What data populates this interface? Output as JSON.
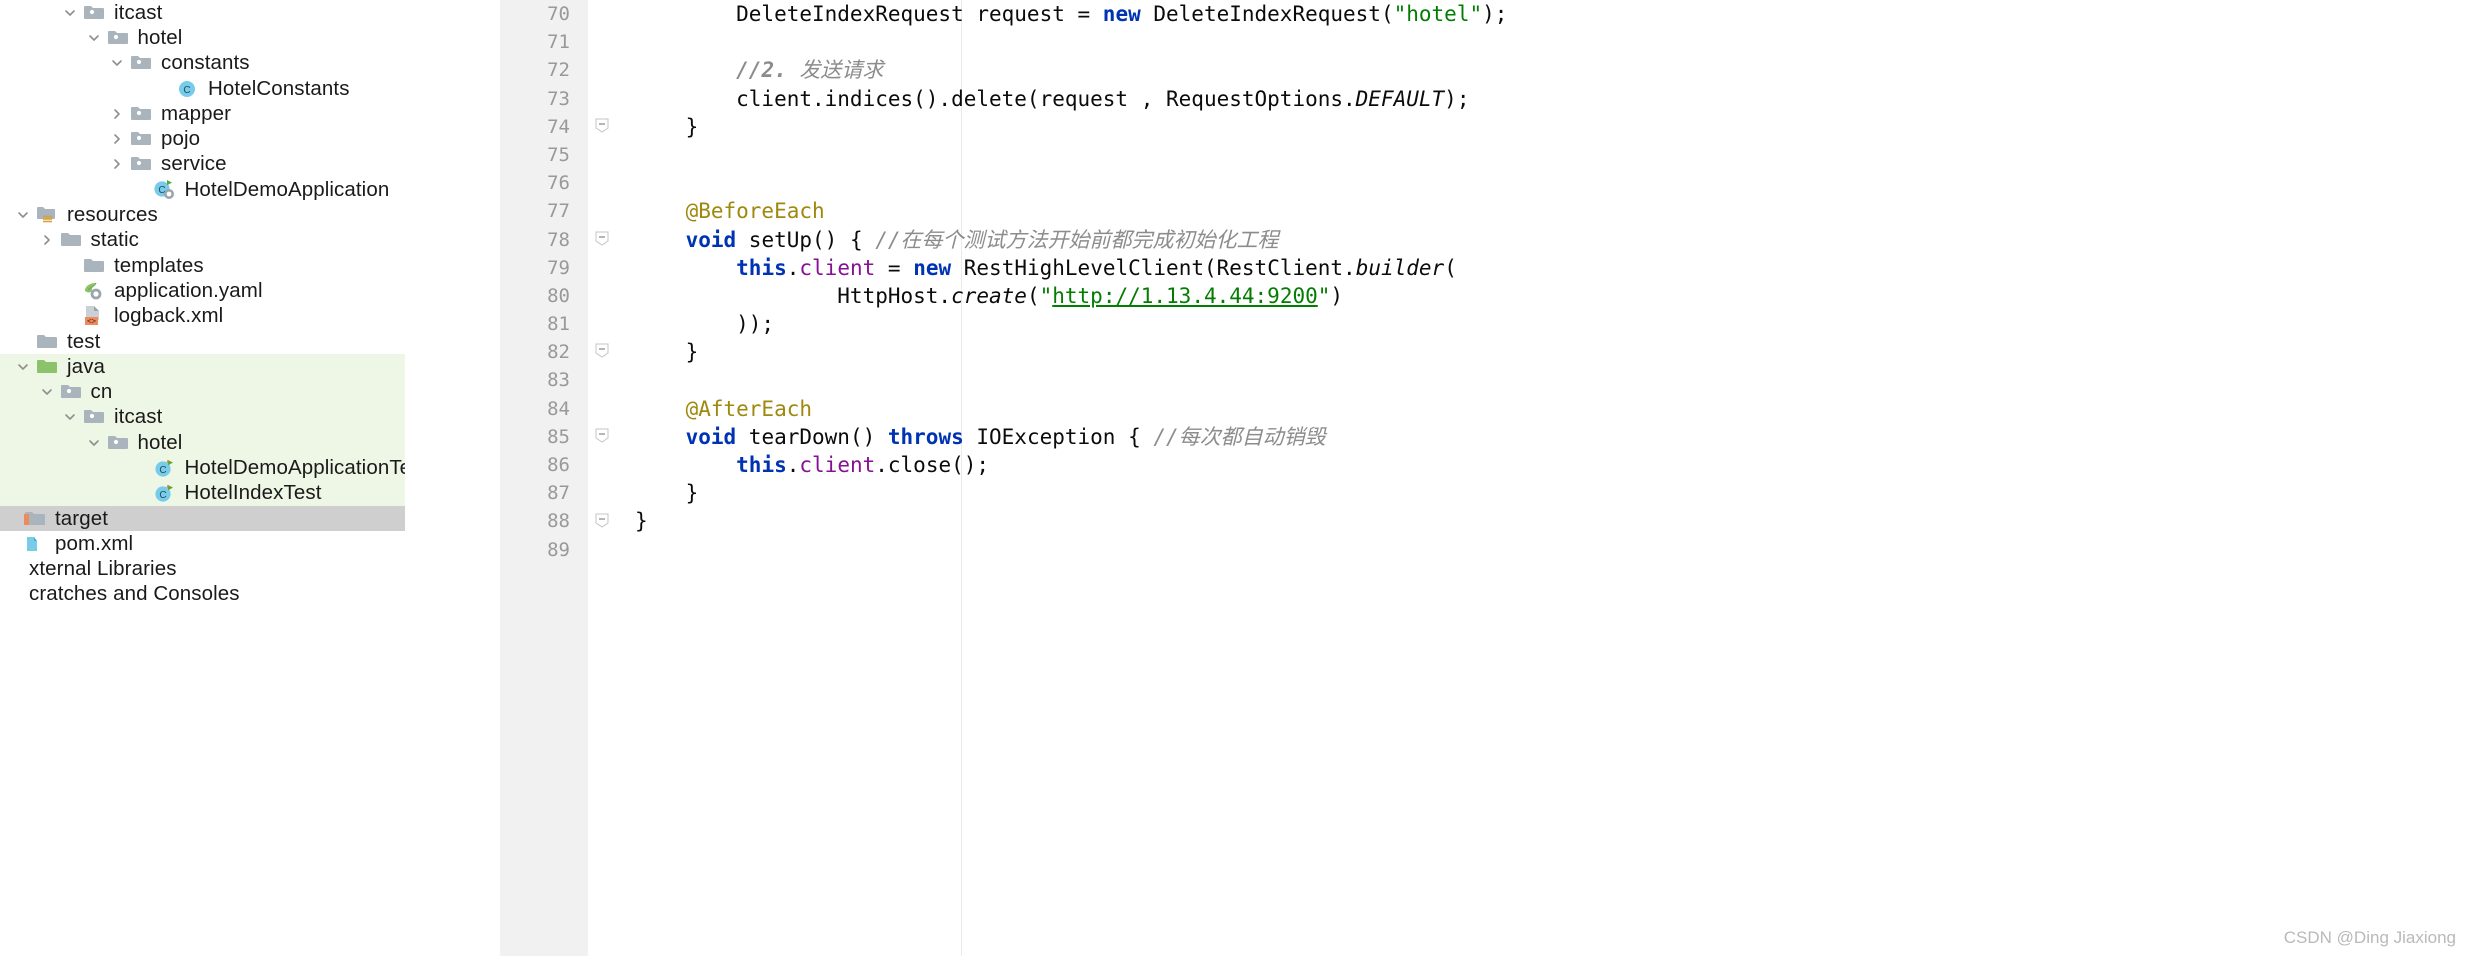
{
  "sidebar": {
    "rows": [
      {
        "indent": 2,
        "twisty": "down",
        "icon": "package-folder",
        "label": "itcast",
        "highlight": "none"
      },
      {
        "indent": 3,
        "twisty": "down",
        "icon": "package-folder",
        "label": "hotel",
        "highlight": "none"
      },
      {
        "indent": 4,
        "twisty": "down",
        "icon": "package-folder",
        "label": "constants",
        "highlight": "none"
      },
      {
        "indent": 6,
        "twisty": "none",
        "icon": "java-class",
        "label": "HotelConstants",
        "highlight": "none"
      },
      {
        "indent": 4,
        "twisty": "right",
        "icon": "package-folder",
        "label": "mapper",
        "highlight": "none"
      },
      {
        "indent": 4,
        "twisty": "right",
        "icon": "package-folder",
        "label": "pojo",
        "highlight": "none"
      },
      {
        "indent": 4,
        "twisty": "right",
        "icon": "package-folder",
        "label": "service",
        "highlight": "none"
      },
      {
        "indent": 5,
        "twisty": "none",
        "icon": "spring-boot-class",
        "label": "HotelDemoApplication",
        "highlight": "none"
      },
      {
        "indent": 0,
        "twisty": "down",
        "icon": "resources-folder",
        "label": "resources",
        "highlight": "none"
      },
      {
        "indent": 1,
        "twisty": "right",
        "icon": "plain-folder",
        "label": "static",
        "highlight": "none"
      },
      {
        "indent": 2,
        "twisty": "none",
        "icon": "plain-folder",
        "label": "templates",
        "highlight": "none"
      },
      {
        "indent": 2,
        "twisty": "none",
        "icon": "spring-yaml",
        "label": "application.yaml",
        "highlight": "none"
      },
      {
        "indent": 2,
        "twisty": "none",
        "icon": "xml-file",
        "label": "logback.xml",
        "highlight": "none"
      },
      {
        "indent": 0,
        "twisty": "none",
        "icon": "plain-folder",
        "label": "test",
        "highlight": "none"
      },
      {
        "indent": 0,
        "twisty": "down",
        "icon": "test-source-folder",
        "label": "java",
        "highlight": "green"
      },
      {
        "indent": 1,
        "twisty": "down",
        "icon": "package-folder",
        "label": "cn",
        "highlight": "green"
      },
      {
        "indent": 2,
        "twisty": "down",
        "icon": "package-folder",
        "label": "itcast",
        "highlight": "green"
      },
      {
        "indent": 3,
        "twisty": "down",
        "icon": "package-folder",
        "label": "hotel",
        "highlight": "green"
      },
      {
        "indent": 5,
        "twisty": "none",
        "icon": "junit-class",
        "label": "HotelDemoApplicationTests",
        "highlight": "green"
      },
      {
        "indent": 5,
        "twisty": "none",
        "icon": "junit-class",
        "label": "HotelIndexTest",
        "highlight": "green"
      },
      {
        "indent": -1,
        "twisty": "none",
        "icon": "target-folder",
        "label": "target",
        "highlight": "gray"
      },
      {
        "indent": -1,
        "twisty": "none",
        "icon": "maven-pom",
        "label": "pom.xml",
        "highlight": "none"
      },
      {
        "indent": -2,
        "twisty": "none",
        "icon": "none",
        "label": "xternal Libraries",
        "highlight": "none"
      },
      {
        "indent": -2,
        "twisty": "none",
        "icon": "none",
        "label": "cratches and Consoles",
        "highlight": "none"
      }
    ]
  },
  "editor": {
    "line_numbers": [
      "70",
      "71",
      "72",
      "73",
      "74",
      "75",
      "76",
      "77",
      "78",
      "79",
      "80",
      "81",
      "82",
      "83",
      "84",
      "85",
      "86",
      "87",
      "88",
      "89"
    ],
    "fold_markers": [
      {
        "line": 4,
        "type": "minus"
      },
      {
        "line": 8,
        "type": "minus"
      },
      {
        "line": 12,
        "type": "minus"
      },
      {
        "line": 15,
        "type": "minus"
      },
      {
        "line": 18,
        "type": "minus"
      }
    ],
    "lines": [
      {
        "n": "70",
        "tokens": [
          {
            "t": "plain",
            "v": "        DeleteIndexRequest request = "
          },
          {
            "t": "kw",
            "v": "new"
          },
          {
            "t": "plain",
            "v": " DeleteIndexRequest("
          },
          {
            "t": "str",
            "v": "\"hotel\""
          },
          {
            "t": "plain",
            "v": ");"
          }
        ]
      },
      {
        "n": "71",
        "tokens": []
      },
      {
        "n": "72",
        "tokens": [
          {
            "t": "plain",
            "v": "        "
          },
          {
            "t": "cmt-b",
            "v": "//2. "
          },
          {
            "t": "cmt",
            "v": "发送请求"
          }
        ]
      },
      {
        "n": "73",
        "tokens": [
          {
            "t": "plain",
            "v": "        client.indices().delete(request , RequestOptions."
          },
          {
            "t": "stat",
            "v": "DEFAULT"
          },
          {
            "t": "plain",
            "v": ");"
          }
        ]
      },
      {
        "n": "74",
        "tokens": [
          {
            "t": "plain",
            "v": "    }"
          }
        ]
      },
      {
        "n": "75",
        "tokens": []
      },
      {
        "n": "76",
        "tokens": []
      },
      {
        "n": "77",
        "tokens": [
          {
            "t": "plain",
            "v": "    "
          },
          {
            "t": "ann",
            "v": "@BeforeEach"
          }
        ]
      },
      {
        "n": "78",
        "tokens": [
          {
            "t": "plain",
            "v": "    "
          },
          {
            "t": "kw",
            "v": "void"
          },
          {
            "t": "plain",
            "v": " setUp() { "
          },
          {
            "t": "cmt",
            "v": "//在每个测试方法开始前都完成初始化工程"
          }
        ]
      },
      {
        "n": "79",
        "tokens": [
          {
            "t": "plain",
            "v": "        "
          },
          {
            "t": "kw",
            "v": "this"
          },
          {
            "t": "plain",
            "v": "."
          },
          {
            "t": "fld",
            "v": "client"
          },
          {
            "t": "plain",
            "v": " = "
          },
          {
            "t": "kw",
            "v": "new"
          },
          {
            "t": "plain",
            "v": " RestHighLevelClient(RestClient."
          },
          {
            "t": "stat",
            "v": "builder"
          },
          {
            "t": "plain",
            "v": "("
          }
        ]
      },
      {
        "n": "80",
        "tokens": [
          {
            "t": "plain",
            "v": "                HttpHost."
          },
          {
            "t": "stat",
            "v": "create"
          },
          {
            "t": "plain",
            "v": "("
          },
          {
            "t": "str",
            "v": "\""
          },
          {
            "t": "url",
            "v": "http://1.13.4.44:9200"
          },
          {
            "t": "str",
            "v": "\""
          },
          {
            "t": "plain",
            "v": ")"
          }
        ]
      },
      {
        "n": "81",
        "tokens": [
          {
            "t": "plain",
            "v": "        ));"
          }
        ]
      },
      {
        "n": "82",
        "tokens": [
          {
            "t": "plain",
            "v": "    }"
          }
        ]
      },
      {
        "n": "83",
        "tokens": []
      },
      {
        "n": "84",
        "tokens": [
          {
            "t": "plain",
            "v": "    "
          },
          {
            "t": "ann",
            "v": "@AfterEach"
          }
        ]
      },
      {
        "n": "85",
        "tokens": [
          {
            "t": "plain",
            "v": "    "
          },
          {
            "t": "kw",
            "v": "void"
          },
          {
            "t": "plain",
            "v": " tearDown() "
          },
          {
            "t": "kw",
            "v": "throws"
          },
          {
            "t": "plain",
            "v": " IOException { "
          },
          {
            "t": "cmt",
            "v": "//每次都自动销毁"
          }
        ]
      },
      {
        "n": "86",
        "tokens": [
          {
            "t": "plain",
            "v": "        "
          },
          {
            "t": "kw",
            "v": "this"
          },
          {
            "t": "plain",
            "v": "."
          },
          {
            "t": "fld",
            "v": "client"
          },
          {
            "t": "plain",
            "v": ".close();"
          }
        ]
      },
      {
        "n": "87",
        "tokens": [
          {
            "t": "plain",
            "v": "    }"
          }
        ]
      },
      {
        "n": "88",
        "tokens": [
          {
            "t": "plain",
            "v": "}"
          }
        ]
      },
      {
        "n": "89",
        "tokens": []
      }
    ]
  },
  "watermark": {
    "text": "CSDN @Ding Jiaxiong"
  },
  "colors": {
    "keyword": "#0033b3",
    "string": "#027d02",
    "comment": "#8c8c8c",
    "annotation": "#9e880d",
    "field": "#871094",
    "gutter_bg": "#f1f1f1",
    "lineno": "#999999",
    "highlight_green": "#eef7e6",
    "highlight_gray": "#cfcfcf",
    "folder_gray": "#a9b4bd",
    "folder_green": "#8cc26a",
    "class_blue": "#76ccea",
    "xml_orange": "#ef8a5f"
  }
}
